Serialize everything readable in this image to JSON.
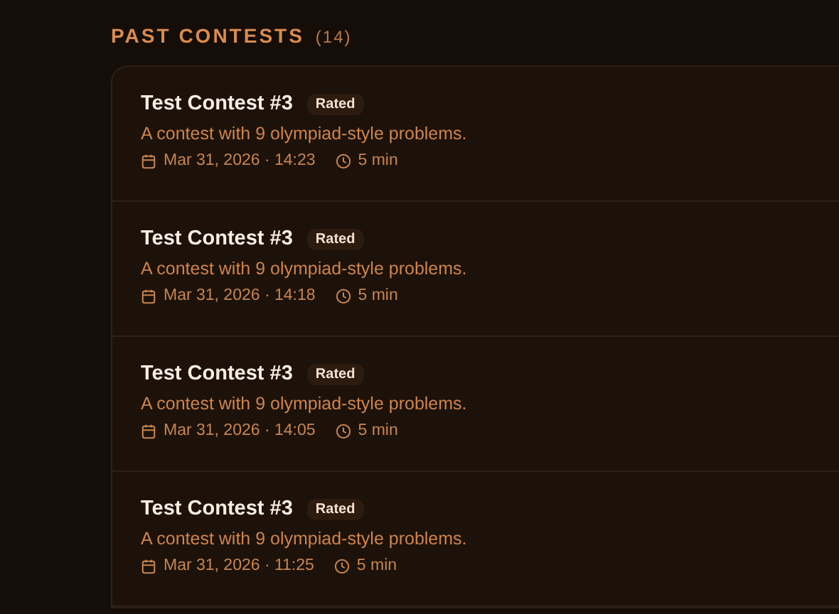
{
  "section": {
    "title": "PAST CONTESTS",
    "count": "(14)"
  },
  "contests": [
    {
      "title": "Test Contest #3",
      "badge": "Rated",
      "description": "A contest with 9 olympiad-style problems.",
      "date": "Mar 31, 2026 · 14:23",
      "duration": "5 min"
    },
    {
      "title": "Test Contest #3",
      "badge": "Rated",
      "description": "A contest with 9 olympiad-style problems.",
      "date": "Mar 31, 2026 · 14:18",
      "duration": "5 min"
    },
    {
      "title": "Test Contest #3",
      "badge": "Rated",
      "description": "A contest with 9 olympiad-style problems.",
      "date": "Mar 31, 2026 · 14:05",
      "duration": "5 min"
    },
    {
      "title": "Test Contest #3",
      "badge": "Rated",
      "description": "A contest with 9 olympiad-style problems.",
      "date": "Mar 31, 2026 · 11:25",
      "duration": "5 min"
    }
  ]
}
